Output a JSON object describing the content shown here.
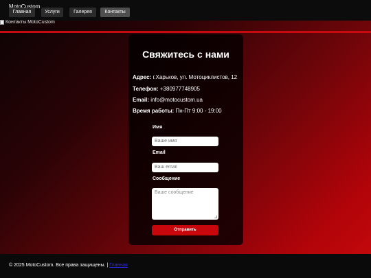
{
  "header": {
    "brand": "MotoCustom",
    "nav": [
      {
        "label": "Главная"
      },
      {
        "label": "Услуги"
      },
      {
        "label": "Галерея"
      },
      {
        "label": "Контакты",
        "active": true
      }
    ]
  },
  "hero": {
    "image_alt": "Контакты MotoCustom"
  },
  "contact": {
    "title": "Свяжитесь с нами",
    "address_label": "Адрес:",
    "address_value": "г.Харьков, ул. Мотоциклистов, 12",
    "phone_label": "Телефон:",
    "phone_value": "+380977748905",
    "email_label": "Email:",
    "email_value": "info@motocustom.ua",
    "hours_label": "Время работы:",
    "hours_value": "Пн-Пт 9:00 - 19:00"
  },
  "form": {
    "name_label": "Имя",
    "name_placeholder": "Ваше имя",
    "email_label": "Email",
    "email_placeholder": "Ваш email",
    "message_label": "Сообщение",
    "message_placeholder": "Ваше  сообщение",
    "submit_label": "Отправить"
  },
  "footer": {
    "copyright": "© 2025 MotoCustom. Все права защищены. |",
    "link_label": "Главная"
  },
  "colors": {
    "accent": "#c8070c",
    "card_bg": "#000000",
    "link": "#2a2aff"
  }
}
